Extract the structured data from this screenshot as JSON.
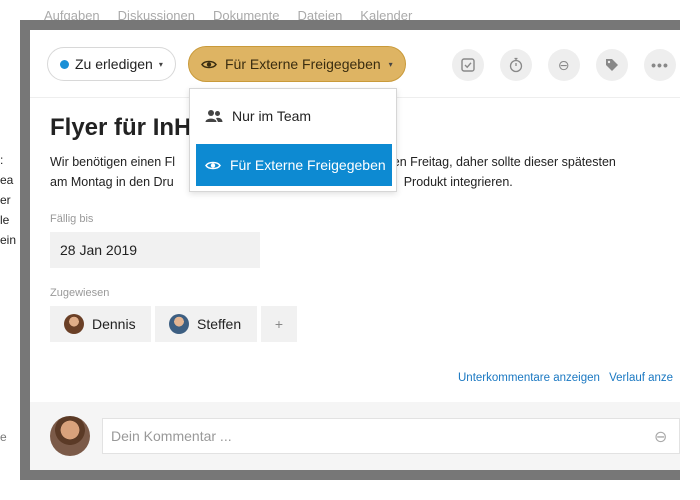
{
  "background": {
    "tabs": [
      "Aufgaben",
      "Diskussionen",
      "Dokumente",
      "Dateien",
      "Kalender"
    ],
    "left_fragments": [
      ":",
      "ea",
      "er",
      "le",
      "ein"
    ],
    "bottom_fragment": "e"
  },
  "task": {
    "status_label": "Zu erledigen",
    "status_color": "#1a8fd6",
    "visibility_label": "Für Externe Freigegeben",
    "visibility_color": "#deb463",
    "toolbar_icons": [
      "checkbox-icon",
      "stopwatch-icon",
      "paperclip-icon",
      "tag-icon",
      "more-icon"
    ],
    "title": "Flyer für InH",
    "description_line1": "Wir benötigen einen Fl",
    "description_line1_end": "sten Freitag, daher sollte dieser spätesten",
    "description_line2": "am Montag in den Dru",
    "description_line2_end": "Produkt integrieren.",
    "due_label": "Fällig bis",
    "due_date": "28 Jan 2019",
    "assigned_label": "Zugewiesen",
    "assignees": [
      {
        "name": "Dennis",
        "avatar_color": "#8a5a3c"
      },
      {
        "name": "Steffen",
        "avatar_color": "#4a6a8a"
      }
    ],
    "add_assignee": "+",
    "link_subcomments": "Unterkommentare anzeigen",
    "link_history": "Verlauf anze"
  },
  "comment": {
    "placeholder": "Dein Kommentar ..."
  },
  "dropdown": {
    "items": [
      {
        "label": "Nur im Team",
        "icon": "team-icon",
        "active": false
      },
      {
        "label": "Für Externe Freigegeben",
        "icon": "eye-icon",
        "active": true
      }
    ]
  }
}
